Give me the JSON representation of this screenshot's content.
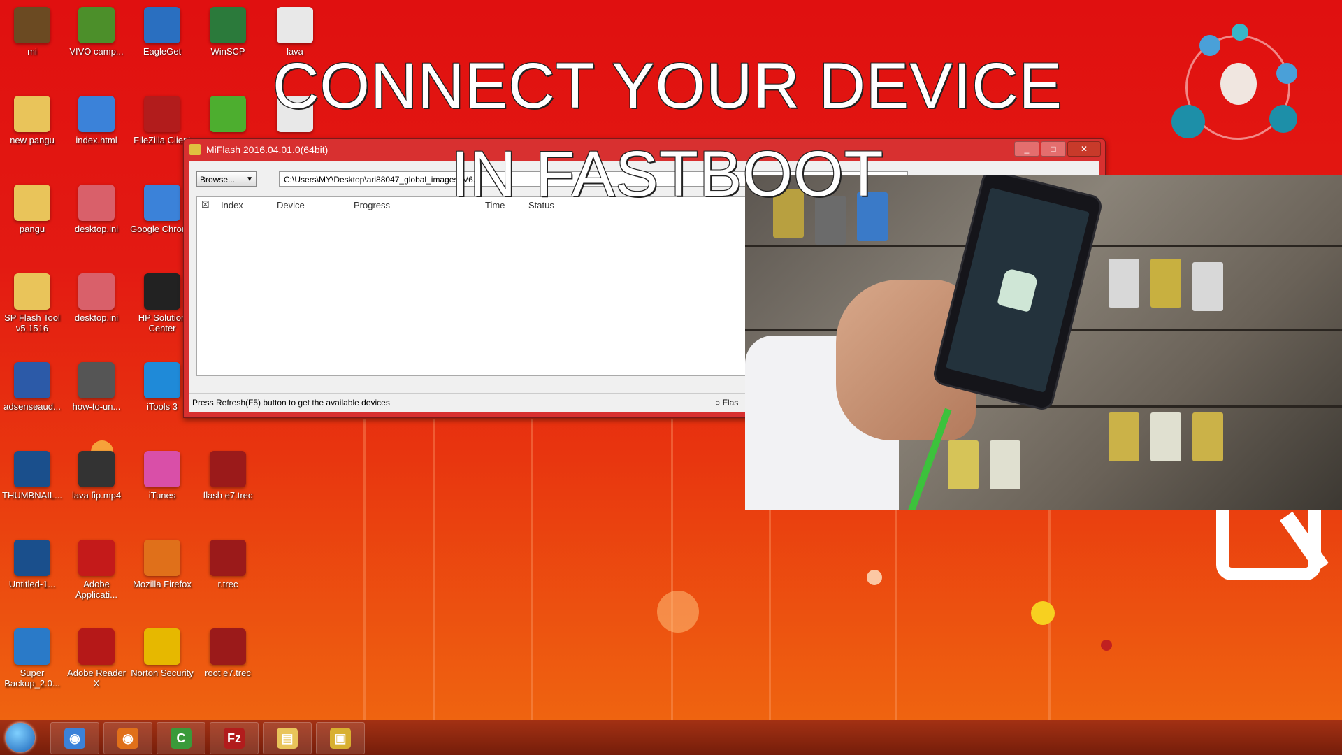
{
  "headline": "CONNECT YOUR DEVICE IN FASTBOOT",
  "desktop_icons": [
    {
      "label": "mi",
      "icon": "winrar-icon",
      "color": "#6b4a22"
    },
    {
      "label": "VIVO camp...",
      "icon": "vivo-icon",
      "color": "#4c8f2a"
    },
    {
      "label": "EagleGet",
      "icon": "eagleget-icon",
      "color": "#2a6fc0"
    },
    {
      "label": "WinSCP",
      "icon": "winscp-icon",
      "color": "#2b7a3b"
    },
    {
      "label": "lava",
      "icon": "file-icon",
      "color": "#e8e8e8"
    },
    {
      "label": "new pangu",
      "icon": "folder-icon",
      "color": "#e9c45a"
    },
    {
      "label": "index.html",
      "icon": "chrome-icon",
      "color": "#3b82d9"
    },
    {
      "label": "FileZilla Client",
      "icon": "filezilla-icon",
      "color": "#b21c1c"
    },
    {
      "label": "",
      "icon": "utorrent-icon",
      "color": "#4dae2f"
    },
    {
      "label": "",
      "icon": "file-icon",
      "color": "#e8e8e8"
    },
    {
      "label": "pangu",
      "icon": "folder-icon",
      "color": "#e9c45a"
    },
    {
      "label": "desktop.ini",
      "icon": "ini-file-icon",
      "color": "#d9606a"
    },
    {
      "label": "Google Chrome",
      "icon": "chrome-icon",
      "color": "#3b82d9"
    },
    {
      "label": "SP Flash Tool v5.1516",
      "icon": "folder-icon",
      "color": "#e9c45a"
    },
    {
      "label": "desktop.ini",
      "icon": "ini-file-icon",
      "color": "#d9606a"
    },
    {
      "label": "HP Solution Center",
      "icon": "hp-icon",
      "color": "#222222"
    },
    {
      "label": "adsenseaud...",
      "icon": "document-icon",
      "color": "#2c5aa8"
    },
    {
      "label": "how-to-un...",
      "icon": "image-file-icon",
      "color": "#555555"
    },
    {
      "label": "iTools 3",
      "icon": "itools-icon",
      "color": "#1f8ad8"
    },
    {
      "label": "THUMBNAIL...",
      "icon": "photoshop-icon",
      "color": "#1a4f8c"
    },
    {
      "label": "lava fip.mp4",
      "icon": "video-file-icon",
      "color": "#333333"
    },
    {
      "label": "iTunes",
      "icon": "itunes-icon",
      "color": "#d94fa8"
    },
    {
      "label": "flash e7.trec",
      "icon": "trec-file-icon",
      "color": "#9b1a1a"
    },
    {
      "label": "Untitled-1...",
      "icon": "photoshop-icon",
      "color": "#1a4f8c"
    },
    {
      "label": "Adobe Applicati...",
      "icon": "adobe-icon",
      "color": "#c41a1a"
    },
    {
      "label": "Mozilla Firefox",
      "icon": "firefox-icon",
      "color": "#e0701a"
    },
    {
      "label": "r.trec",
      "icon": "trec-file-icon",
      "color": "#9b1a1a"
    },
    {
      "label": "Super Backup_2.0...",
      "icon": "apk-icon",
      "color": "#2a7ac8"
    },
    {
      "label": "Adobe Reader X",
      "icon": "acrobat-icon",
      "color": "#b51818"
    },
    {
      "label": "Norton Security",
      "icon": "norton-icon",
      "color": "#e6b800"
    },
    {
      "label": "root e7.trec",
      "icon": "trec-file-icon",
      "color": "#9b1a1a"
    }
  ],
  "miflash": {
    "title": "MiFlash 2016.04.01.0(64bit)",
    "browse_label": "Browse...",
    "path_value": "C:\\Users\\MY\\Desktop\\ari88047_global_images_V6...",
    "columns": [
      "Index",
      "Device",
      "Progress",
      "Time",
      "Status"
    ],
    "status_text": "Press Refresh(F5) button to get the available devices",
    "flash_option": "Flas"
  },
  "taskbar": [
    {
      "icon": "chrome-icon",
      "color": "#3b82d9",
      "glyph": "◉"
    },
    {
      "icon": "firefox-icon",
      "color": "#e0701a",
      "glyph": "◉"
    },
    {
      "icon": "camtasia-icon",
      "color": "#3a9a3a",
      "glyph": "C"
    },
    {
      "icon": "filezilla-icon",
      "color": "#b21c1c",
      "glyph": "Fz"
    },
    {
      "icon": "explorer-icon",
      "color": "#e9c45a",
      "glyph": "▤"
    },
    {
      "icon": "miflash-icon",
      "color": "#d8b030",
      "glyph": "▣"
    }
  ]
}
